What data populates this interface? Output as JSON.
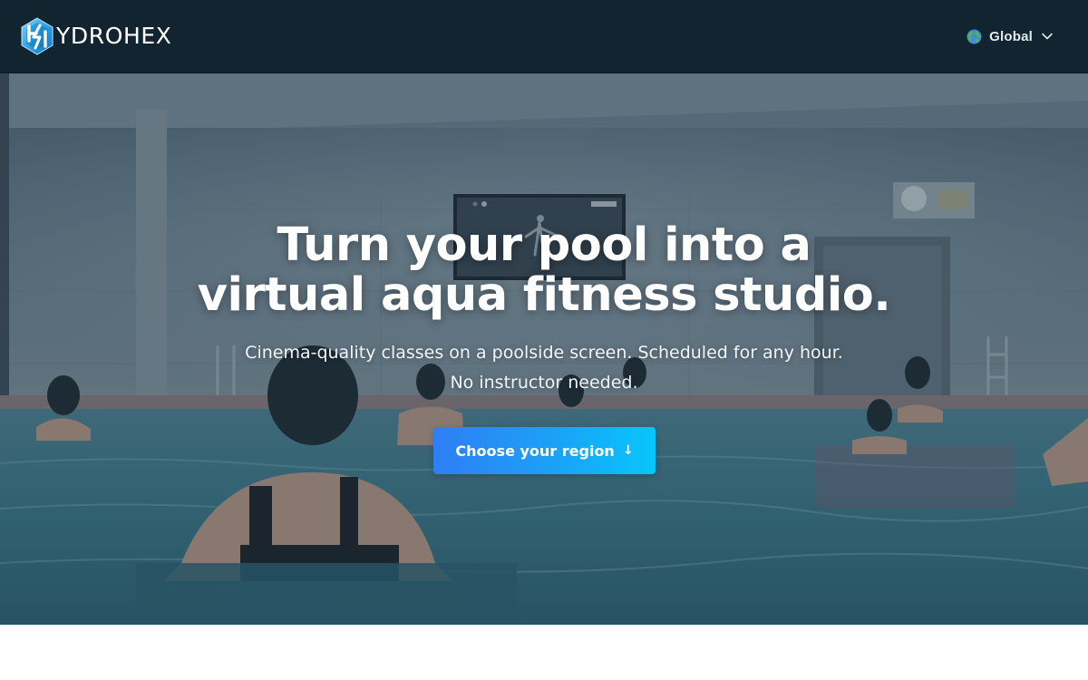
{
  "header": {
    "logo_text": "YDROHEX",
    "region": {
      "icon": "globe-icon",
      "label": "Global",
      "chevron_icon": "chevron-down-icon"
    }
  },
  "hero": {
    "title_line1": "Turn your pool into a",
    "title_line2": "virtual aqua fitness studio.",
    "subtitle_line1": "Cinema-quality classes on a poolside screen. Scheduled for any hour.",
    "subtitle_line2": "No instructor needed.",
    "cta_label": "Choose your region",
    "cta_arrow": "↓",
    "background_image": "people doing aqua fitness in an indoor pool facing a wall-mounted screen"
  },
  "colors": {
    "header_bg": "#11242f",
    "cta_gradient_start": "#2f7ef4",
    "cta_gradient_end": "#07c6fb",
    "text_on_dark": "#ffffff"
  }
}
